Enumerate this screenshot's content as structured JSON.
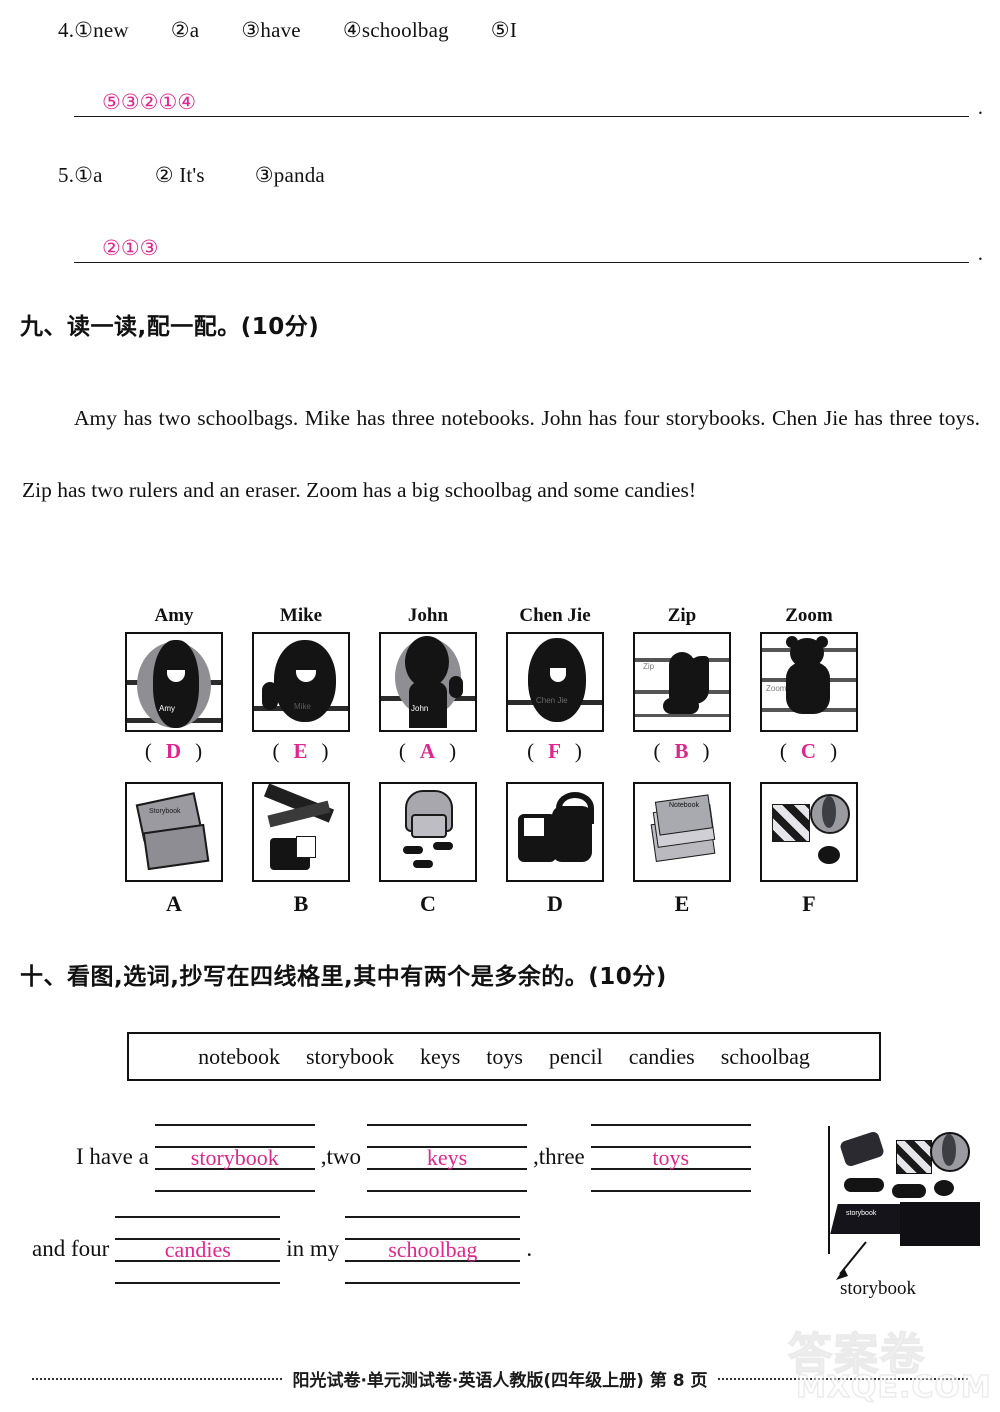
{
  "ordering": {
    "items": [
      {
        "number": "4.",
        "options": [
          "①new",
          "②a",
          "③have",
          "④schoolbag",
          "⑤I"
        ],
        "answer": "⑤③②①④",
        "end_punct": "."
      },
      {
        "number": "5.",
        "options": [
          "①a",
          "② It's",
          "③panda"
        ],
        "answer": "②①③",
        "end_punct": "."
      }
    ]
  },
  "section_nine": {
    "heading": "九、读一读,配一配。(10分)",
    "passage": "Amy has two schoolbags. Mike has three notebooks. John has four storybooks. Chen Jie has three toys. Zip has two rulers and an eraser. Zoom has a big schoolbag and some candies!",
    "people": [
      {
        "name": "Amy",
        "answer": "D",
        "picture": "girl-with-schoolbag-photo"
      },
      {
        "name": "Mike",
        "answer": "E",
        "picture": "boy-waving-photo"
      },
      {
        "name": "John",
        "answer": "A",
        "picture": "boy-raising-hand-photo"
      },
      {
        "name": "Chen Jie",
        "answer": "F",
        "picture": "girl-photo"
      },
      {
        "name": "Zip",
        "answer": "B",
        "picture": "squirrel-cartoon"
      },
      {
        "name": "Zoom",
        "answer": "C",
        "picture": "bear-cartoon"
      }
    ],
    "objects": [
      {
        "label": "A",
        "picture": "storybooks-icon"
      },
      {
        "label": "B",
        "picture": "ruler-and-eraser-icon"
      },
      {
        "label": "C",
        "picture": "schoolbag-and-candies-icon"
      },
      {
        "label": "D",
        "picture": "two-schoolbags-icon"
      },
      {
        "label": "E",
        "picture": "notebooks-icon"
      },
      {
        "label": "F",
        "picture": "toys-icon"
      }
    ]
  },
  "section_ten": {
    "heading": "十、看图,选词,抄写在四线格里,其中有两个是多余的。(10分)",
    "word_bank": [
      "notebook",
      "storybook",
      "keys",
      "toys",
      "pencil",
      "candies",
      "schoolbag"
    ],
    "sentence_line_1": {
      "lead": "I have a",
      "blank1": "storybook",
      "mid1": ",two",
      "blank2": "keys",
      "mid2": ",three",
      "blank3": "toys"
    },
    "sentence_line_2": {
      "lead": "and four",
      "blank4": "candies",
      "mid": "in my",
      "blank5": "schoolbag",
      "end": "."
    },
    "photo_caption": "storybook",
    "photo_alt": "desk-items-photo"
  },
  "footer": {
    "text": "阳光试卷·单元测试卷·英语人教版(四年级上册)  第 8 页"
  },
  "watermark": {
    "cn": "答案卷",
    "en": "MXQE.COM"
  },
  "colors": {
    "answer_pink": "#e0268c",
    "ink": "#111111"
  }
}
